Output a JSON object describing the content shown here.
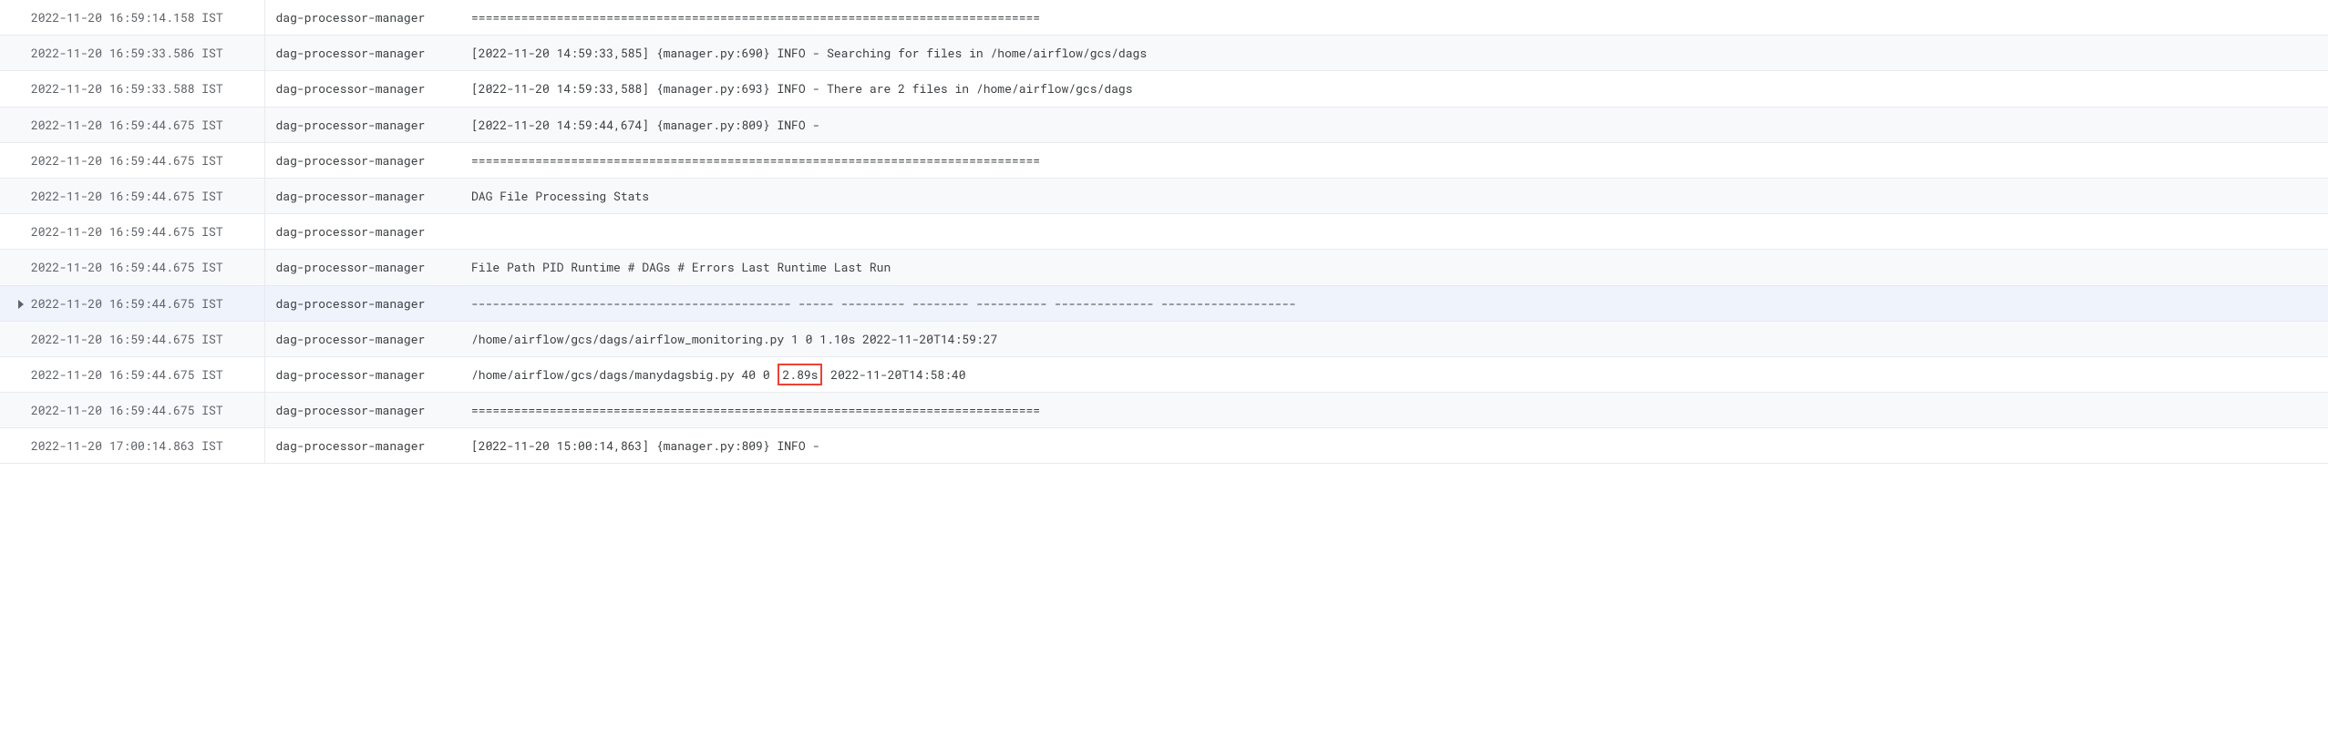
{
  "highlight_target": "2.89s",
  "rows": [
    {
      "timestamp": "2022-11-20 16:59:14.158 IST",
      "source": "dag-processor-manager",
      "message": "================================================================================"
    },
    {
      "timestamp": "2022-11-20 16:59:33.586 IST",
      "source": "dag-processor-manager",
      "message": "[2022-11-20 14:59:33,585] {manager.py:690} INFO - Searching for files in /home/airflow/gcs/dags"
    },
    {
      "timestamp": "2022-11-20 16:59:33.588 IST",
      "source": "dag-processor-manager",
      "message": "[2022-11-20 14:59:33,588] {manager.py:693} INFO - There are 2 files in /home/airflow/gcs/dags"
    },
    {
      "timestamp": "2022-11-20 16:59:44.675 IST",
      "source": "dag-processor-manager",
      "message": "[2022-11-20 14:59:44,674] {manager.py:809} INFO - "
    },
    {
      "timestamp": "2022-11-20 16:59:44.675 IST",
      "source": "dag-processor-manager",
      "message": "================================================================================"
    },
    {
      "timestamp": "2022-11-20 16:59:44.675 IST",
      "source": "dag-processor-manager",
      "message": "DAG File Processing Stats"
    },
    {
      "timestamp": "2022-11-20 16:59:44.675 IST",
      "source": "dag-processor-manager",
      "message": ""
    },
    {
      "timestamp": "2022-11-20 16:59:44.675 IST",
      "source": "dag-processor-manager",
      "message": "File Path PID Runtime # DAGs # Errors Last Runtime Last Run"
    },
    {
      "timestamp": "2022-11-20 16:59:44.675 IST",
      "source": "dag-processor-manager",
      "message": "--------------------------------------------- ----- --------- -------- ---------- -------------- -------------------",
      "hovered": true
    },
    {
      "timestamp": "2022-11-20 16:59:44.675 IST",
      "source": "dag-processor-manager",
      "message": "/home/airflow/gcs/dags/airflow_monitoring.py 1 0 1.10s 2022-11-20T14:59:27"
    },
    {
      "timestamp": "2022-11-20 16:59:44.675 IST",
      "source": "dag-processor-manager",
      "message": "/home/airflow/gcs/dags/manydagsbig.py 40 0 2.89s 2022-11-20T14:58:40",
      "highlight": "2.89s"
    },
    {
      "timestamp": "2022-11-20 16:59:44.675 IST",
      "source": "dag-processor-manager",
      "message": "================================================================================"
    },
    {
      "timestamp": "2022-11-20 17:00:14.863 IST",
      "source": "dag-processor-manager",
      "message": "[2022-11-20 15:00:14,863] {manager.py:809} INFO - "
    }
  ]
}
